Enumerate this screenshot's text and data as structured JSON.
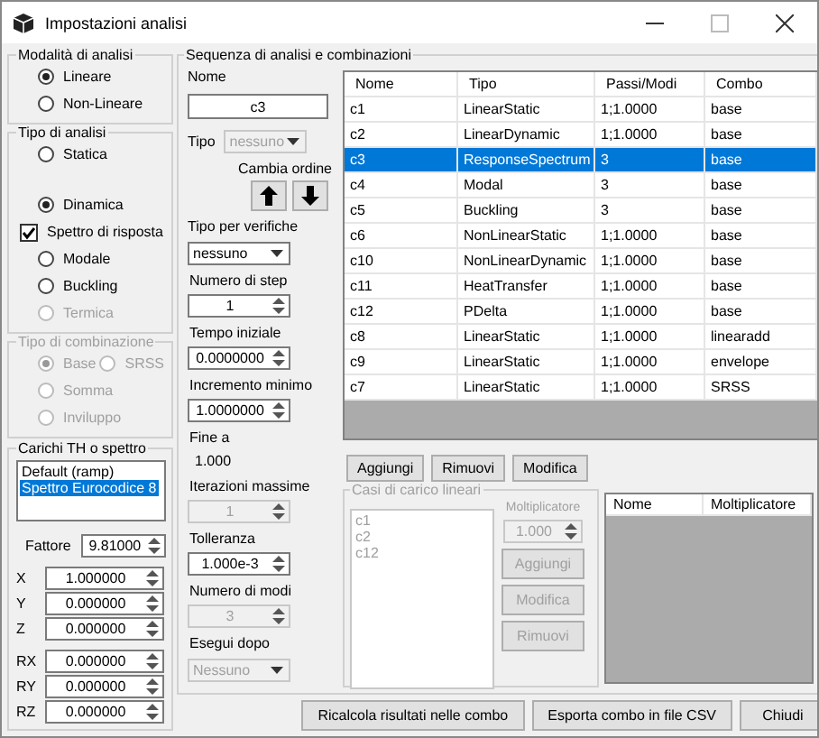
{
  "window": {
    "title": "Impostazioni analisi"
  },
  "analysis_mode": {
    "title": "Modalità di analisi",
    "options": [
      {
        "label": "Lineare",
        "selected": true
      },
      {
        "label": "Non-Lineare",
        "selected": false
      }
    ]
  },
  "analysis_type": {
    "title": "Tipo di analisi",
    "items": [
      {
        "kind": "radio",
        "label": "Statica",
        "selected": false,
        "disabled": false
      },
      {
        "kind": "radio",
        "label": "Dinamica",
        "selected": true,
        "disabled": false
      },
      {
        "kind": "checkbox",
        "label": "Spettro di risposta",
        "checked": true,
        "disabled": false
      },
      {
        "kind": "radio",
        "label": "Modale",
        "selected": false,
        "disabled": false
      },
      {
        "kind": "radio",
        "label": "Buckling",
        "selected": false,
        "disabled": false
      },
      {
        "kind": "radio",
        "label": "Termica",
        "selected": false,
        "disabled": true
      }
    ]
  },
  "combination_type": {
    "title": "Tipo di combinazione",
    "disabled": true,
    "options": [
      {
        "label": "Base",
        "selected": true
      },
      {
        "label": "SRSS",
        "selected": false
      },
      {
        "label": "Somma",
        "selected": false
      },
      {
        "label": "Inviluppo",
        "selected": false
      }
    ]
  },
  "loads": {
    "title": "Carichi TH o spettro",
    "list": [
      {
        "label": "Default (ramp)",
        "selected": false
      },
      {
        "label": "Spettro Eurocodice 8",
        "selected": true
      }
    ],
    "factor": {
      "label": "Fattore",
      "value": "9.81000"
    },
    "components": [
      {
        "label": "X",
        "value": "1.000000"
      },
      {
        "label": "Y",
        "value": "0.000000"
      },
      {
        "label": "Z",
        "value": "0.000000"
      },
      {
        "label": "RX",
        "value": "0.000000"
      },
      {
        "label": "RY",
        "value": "0.000000"
      },
      {
        "label": "RZ",
        "value": "0.000000"
      }
    ]
  },
  "sequence": {
    "title": "Sequenza di analisi e combinazioni",
    "name": {
      "label": "Nome",
      "value": "c3"
    },
    "type": {
      "label": "Tipo",
      "value": "nessuno",
      "disabled": true
    },
    "reorder": {
      "label": "Cambia ordine"
    },
    "check_type": {
      "label": "Tipo per verifiche",
      "value": "nessuno",
      "disabled": false
    },
    "fields": [
      {
        "kind": "spin",
        "label": "Numero di step",
        "value": "1",
        "disabled": false
      },
      {
        "kind": "spin",
        "label": "Tempo iniziale",
        "value": "0.0000000",
        "disabled": false
      },
      {
        "kind": "spin",
        "label": "Incremento minimo",
        "value": "1.0000000",
        "disabled": false
      },
      {
        "kind": "text",
        "label": "Fine a",
        "value": "1.000",
        "disabled": false
      },
      {
        "kind": "spin",
        "label": "Iterazioni massime",
        "value": "1",
        "disabled": true
      },
      {
        "kind": "spin",
        "label": "Tolleranza",
        "value": "1.000e-3",
        "disabled": false
      },
      {
        "kind": "spin",
        "label": "Numero di modi",
        "value": "3",
        "disabled": true
      },
      {
        "kind": "dropdown",
        "label": "Esegui dopo",
        "value": "Nessuno",
        "disabled": true
      }
    ],
    "table": {
      "columns": [
        "Nome",
        "Tipo",
        "Passi/Modi",
        "Combo"
      ],
      "rows": [
        {
          "cells": [
            "c1",
            "LinearStatic",
            "1;1.0000",
            "base"
          ],
          "selected": false
        },
        {
          "cells": [
            "c2",
            "LinearDynamic",
            "1;1.0000",
            "base"
          ],
          "selected": false
        },
        {
          "cells": [
            "c3",
            "ResponseSpectrum",
            "3",
            "base"
          ],
          "selected": true
        },
        {
          "cells": [
            "c4",
            "Modal",
            "3",
            "base"
          ],
          "selected": false
        },
        {
          "cells": [
            "c5",
            "Buckling",
            "3",
            "base"
          ],
          "selected": false
        },
        {
          "cells": [
            "c6",
            "NonLinearStatic",
            "1;1.0000",
            "base"
          ],
          "selected": false
        },
        {
          "cells": [
            "c10",
            "NonLinearDynamic",
            "1;1.0000",
            "base"
          ],
          "selected": false
        },
        {
          "cells": [
            "c11",
            "HeatTransfer",
            "1;1.0000",
            "base"
          ],
          "selected": false
        },
        {
          "cells": [
            "c12",
            "PDelta",
            "1;1.0000",
            "base"
          ],
          "selected": false
        },
        {
          "cells": [
            "c8",
            "LinearStatic",
            "1;1.0000",
            "linearadd"
          ],
          "selected": false
        },
        {
          "cells": [
            "c9",
            "LinearStatic",
            "1;1.0000",
            "envelope"
          ],
          "selected": false
        },
        {
          "cells": [
            "c7",
            "LinearStatic",
            "1;1.0000",
            "SRSS"
          ],
          "selected": false
        }
      ]
    },
    "buttons": [
      "Aggiungi",
      "Rimuovi",
      "Modifica"
    ],
    "linear_cases": {
      "title": "Casi di carico lineari",
      "disabled": true,
      "list": [
        "c1",
        "c2",
        "c12"
      ],
      "multiplier": {
        "label": "Moltiplicatore",
        "value": "1.000"
      },
      "buttons": [
        "Aggiungi",
        "Modifica",
        "Rimuovi"
      ],
      "table": {
        "columns": [
          "Nome",
          "Moltiplicatore"
        ]
      }
    }
  },
  "footer_buttons": [
    "Ricalcola risultati nelle combo",
    "Esporta combo in file CSV",
    "Chiudi"
  ]
}
